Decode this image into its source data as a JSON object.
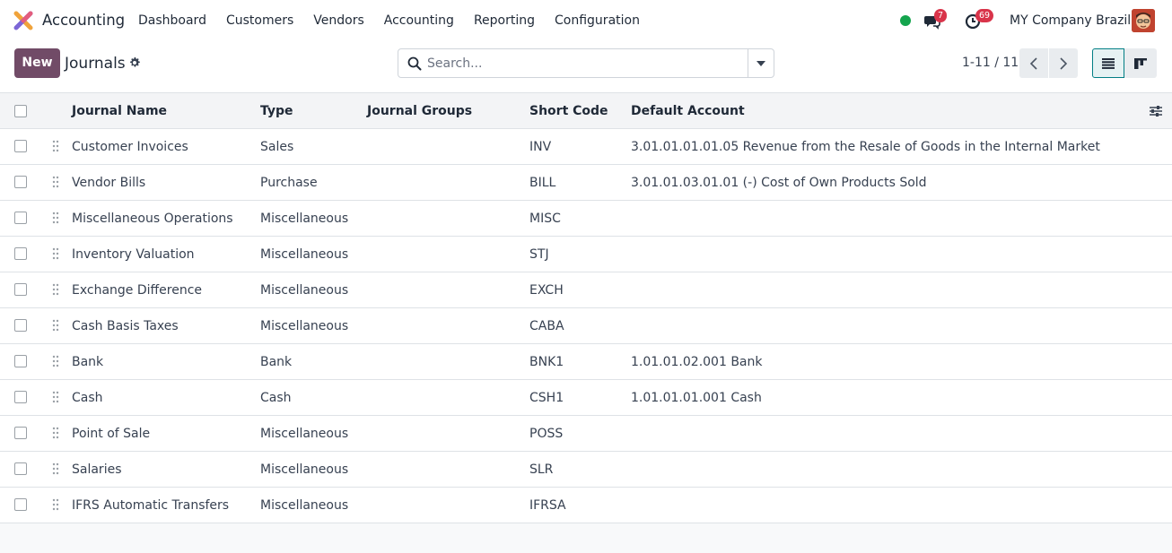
{
  "navbar": {
    "app_name": "Accounting",
    "menu": [
      "Dashboard",
      "Customers",
      "Vendors",
      "Accounting",
      "Reporting",
      "Configuration"
    ],
    "messages_badge": "7",
    "activities_badge": "69",
    "company": "MY Company Brazil",
    "presence_color": "#14a44d"
  },
  "control_panel": {
    "new_label": "New",
    "title": "Journals",
    "search_placeholder": "Search...",
    "pager": "1-11 / 11"
  },
  "list": {
    "headers": {
      "name": "Journal Name",
      "type": "Type",
      "groups": "Journal Groups",
      "code": "Short Code",
      "account": "Default Account"
    },
    "rows": [
      {
        "name": "Customer Invoices",
        "type": "Sales",
        "groups": "",
        "code": "INV",
        "account": "3.01.01.01.01.05 Revenue from the Resale of Goods in the Internal Market"
      },
      {
        "name": "Vendor Bills",
        "type": "Purchase",
        "groups": "",
        "code": "BILL",
        "account": "3.01.01.03.01.01 (-) Cost of Own Products Sold"
      },
      {
        "name": "Miscellaneous Operations",
        "type": "Miscellaneous",
        "groups": "",
        "code": "MISC",
        "account": ""
      },
      {
        "name": "Inventory Valuation",
        "type": "Miscellaneous",
        "groups": "",
        "code": "STJ",
        "account": ""
      },
      {
        "name": "Exchange Difference",
        "type": "Miscellaneous",
        "groups": "",
        "code": "EXCH",
        "account": ""
      },
      {
        "name": "Cash Basis Taxes",
        "type": "Miscellaneous",
        "groups": "",
        "code": "CABA",
        "account": ""
      },
      {
        "name": "Bank",
        "type": "Bank",
        "groups": "",
        "code": "BNK1",
        "account": "1.01.01.02.001 Bank"
      },
      {
        "name": "Cash",
        "type": "Cash",
        "groups": "",
        "code": "CSH1",
        "account": "1.01.01.01.001 Cash"
      },
      {
        "name": "Point of Sale",
        "type": "Miscellaneous",
        "groups": "",
        "code": "POSS",
        "account": ""
      },
      {
        "name": "Salaries",
        "type": "Miscellaneous",
        "groups": "",
        "code": "SLR",
        "account": ""
      },
      {
        "name": "IFRS Automatic Transfers",
        "type": "Miscellaneous",
        "groups": "",
        "code": "IFRSA",
        "account": ""
      }
    ]
  },
  "colors": {
    "brand": "#714b67",
    "accent": "#017e84",
    "badge": "#d9344a"
  }
}
